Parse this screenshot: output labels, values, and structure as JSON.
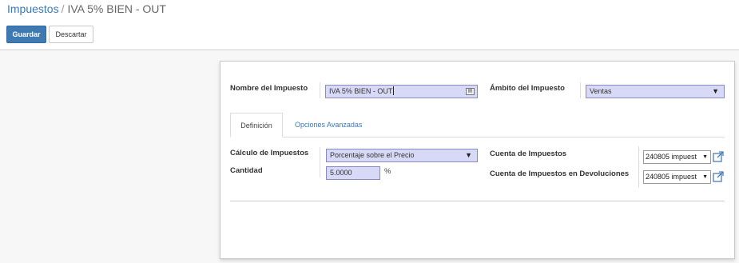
{
  "breadcrumb": {
    "parent": "Impuestos",
    "separator": "/",
    "current": "IVA 5% BIEN - OUT"
  },
  "toolbar": {
    "save_label": "Guardar",
    "discard_label": "Descartar"
  },
  "form": {
    "tax_name": {
      "label": "Nombre del Impuesto",
      "value": "IVA   5%  BIEN - OUT"
    },
    "tax_scope": {
      "label": "Ámbito del Impuesto",
      "value": "Ventas"
    },
    "tabs": [
      {
        "label": "Definición",
        "active": true
      },
      {
        "label": "Opciones Avanzadas",
        "active": false
      }
    ],
    "computation": {
      "label": "Cálculo de Impuestos",
      "value": "Porcentaje sobre el Precio"
    },
    "amount": {
      "label": "Cantidad",
      "value": "5.0000",
      "unit": "%"
    },
    "tax_account": {
      "label": "Cuenta de Impuestos",
      "value": "240805 impuest"
    },
    "refund_account": {
      "label": "Cuenta de Impuestos en Devoluciones",
      "value": "240805 impuest"
    }
  },
  "icons": {
    "translate": "translate-icon",
    "dropdown": "triangle-down",
    "external": "external-link-icon"
  },
  "colors": {
    "accent": "#3b78b4",
    "primary_button": "#3f79b2",
    "required_field": "#d8d8f7"
  }
}
